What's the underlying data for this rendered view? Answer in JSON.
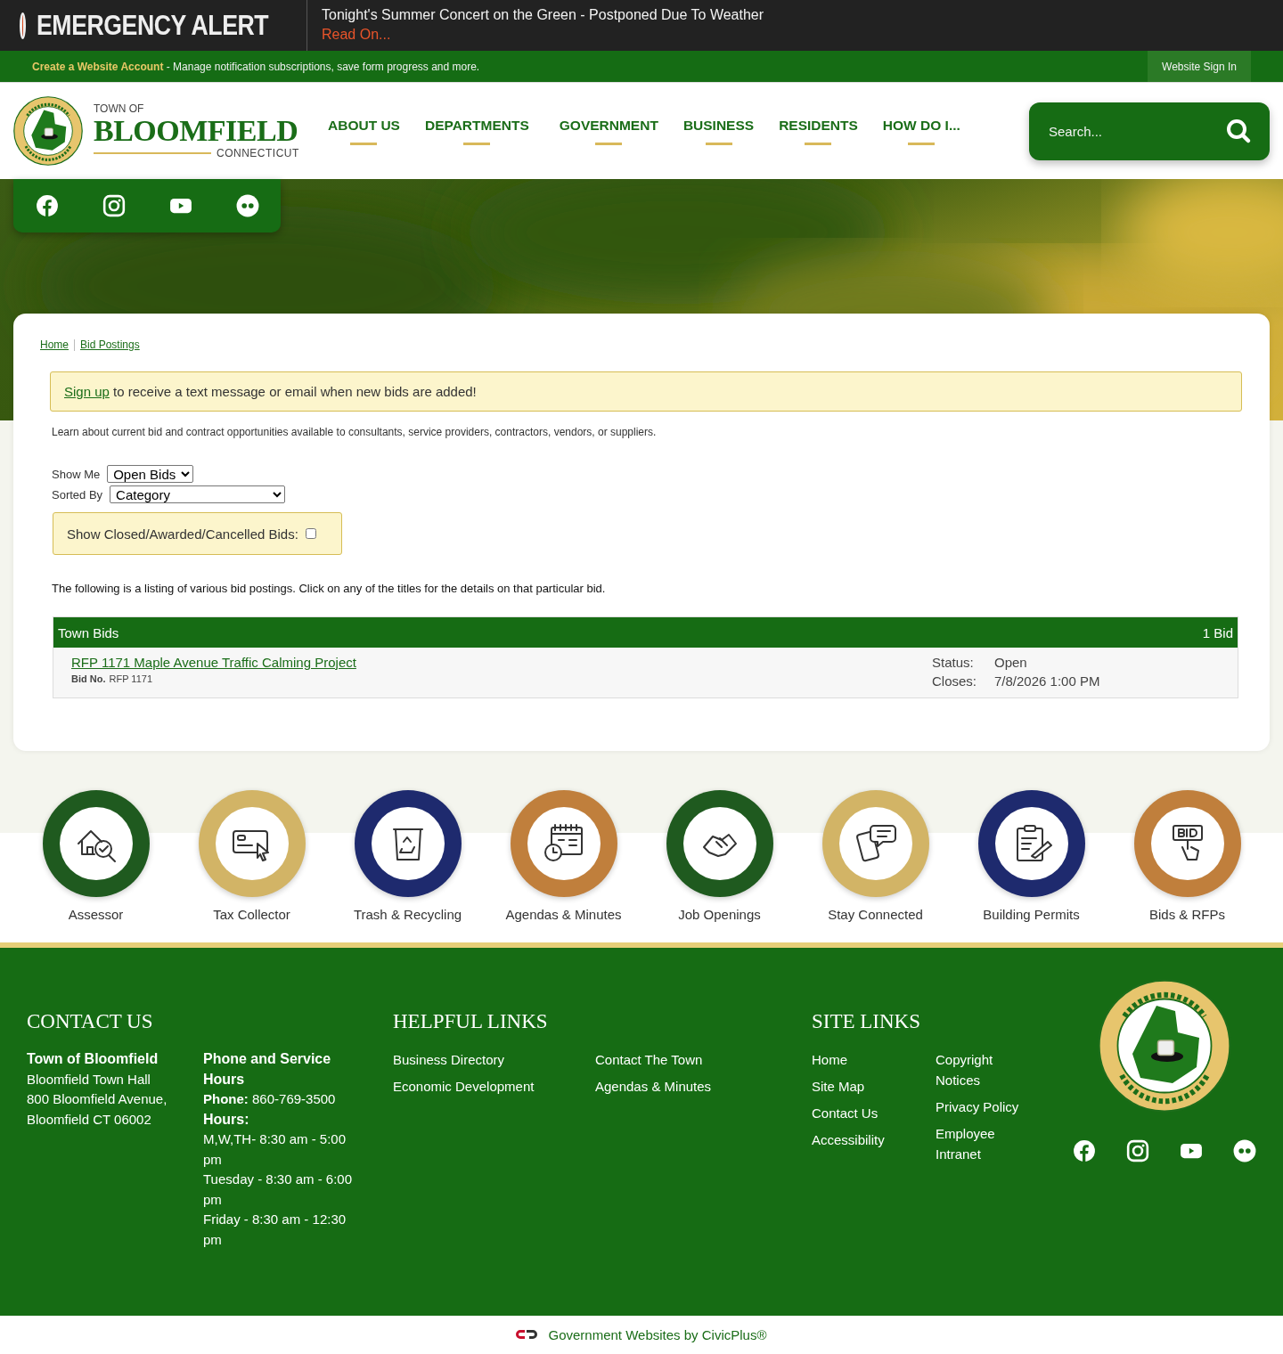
{
  "alert": {
    "label": "EMERGENCY ALERT",
    "message": "Tonight's Summer Concert on the Green - Postponed Due To Weather",
    "link": "Read On..."
  },
  "account_bar": {
    "link": "Create a Website Account",
    "text": " - Manage notification subscriptions, save form progress and more.",
    "sign_in": "Website Sign In"
  },
  "header": {
    "logo": {
      "town_of": "TOWN OF",
      "name": "BLOOMFIELD",
      "state": "CONNECTICUT"
    },
    "nav": [
      "ABOUT US",
      "DEPARTMENTS",
      "GOVERNMENT",
      "BUSINESS",
      "RESIDENTS",
      "HOW DO I..."
    ],
    "search": {
      "placeholder": "Search..."
    }
  },
  "breadcrumbs": [
    "Home",
    "Bid Postings"
  ],
  "notice": {
    "link": "Sign up",
    "text": " to receive a text message or email when new bids are added!"
  },
  "intro": "Learn about current bid and contract opportunities available to consultants, service providers, contractors, vendors, or suppliers.",
  "filters": {
    "show_me": {
      "label": "Show Me",
      "value": "Open Bids"
    },
    "sorted_by": {
      "label": "Sorted By",
      "value": "Category"
    },
    "closed": {
      "label": "Show Closed/Awarded/Cancelled Bids:",
      "checked": false
    }
  },
  "listing_text": "The following is a listing of various bid postings. Click on any of the titles for the details on that particular bid.",
  "bid_table": {
    "title": "Town Bids",
    "count": "1 Bid",
    "rows": [
      {
        "title": "RFP 1171 Maple Avenue Traffic Calming Project",
        "bid_no_label": "Bid No.",
        "bid_no": "RFP 1171",
        "status_label": "Status:",
        "status": "Open",
        "closes_label": "Closes:",
        "closes": "7/8/2026 1:00 PM"
      }
    ]
  },
  "quick_links": [
    {
      "label": "Assessor",
      "color": "#1f5a1f"
    },
    {
      "label": "Tax Collector",
      "color": "#d2b466"
    },
    {
      "label": "Trash & Recycling",
      "color": "#1e2a6e"
    },
    {
      "label": "Agendas & Minutes",
      "color": "#c07f3c"
    },
    {
      "label": "Job Openings",
      "color": "#1f5a1f"
    },
    {
      "label": "Stay Connected",
      "color": "#d2b466"
    },
    {
      "label": "Building Permits",
      "color": "#1e2a6e"
    },
    {
      "label": "Bids & RFPs",
      "color": "#c07f3c"
    }
  ],
  "footer": {
    "contact": {
      "heading": "CONTACT US",
      "name": "Town of Bloomfield",
      "lines": [
        "Bloomfield Town Hall",
        "800 Bloomfield Avenue,",
        "Bloomfield CT 06002"
      ],
      "hours_heading": "Phone and Service Hours",
      "phone": "**Phone:** 860-769-3500",
      "hours_label": "Hours:",
      "hours": [
        "M,W,TH- 8:30 am - 5:00 pm",
        "Tuesday - 8:30 am - 6:00 pm",
        "Friday - 8:30 am - 12:30 pm"
      ]
    },
    "helpful_links": {
      "heading": "HELPFUL LINKS",
      "columns": [
        [
          "Business Directory",
          "Economic Development"
        ],
        [
          "Contact The Town",
          "Agendas & Minutes"
        ]
      ]
    },
    "site_links": {
      "heading": "SITE LINKS",
      "columns": [
        [
          "Home",
          "Site Map",
          "Contact Us",
          "Accessibility"
        ],
        [
          "Copyright Notices",
          "Privacy Policy",
          "Employee Intranet"
        ]
      ]
    }
  },
  "powered_by": "Government Websites by CivicPlus®"
}
